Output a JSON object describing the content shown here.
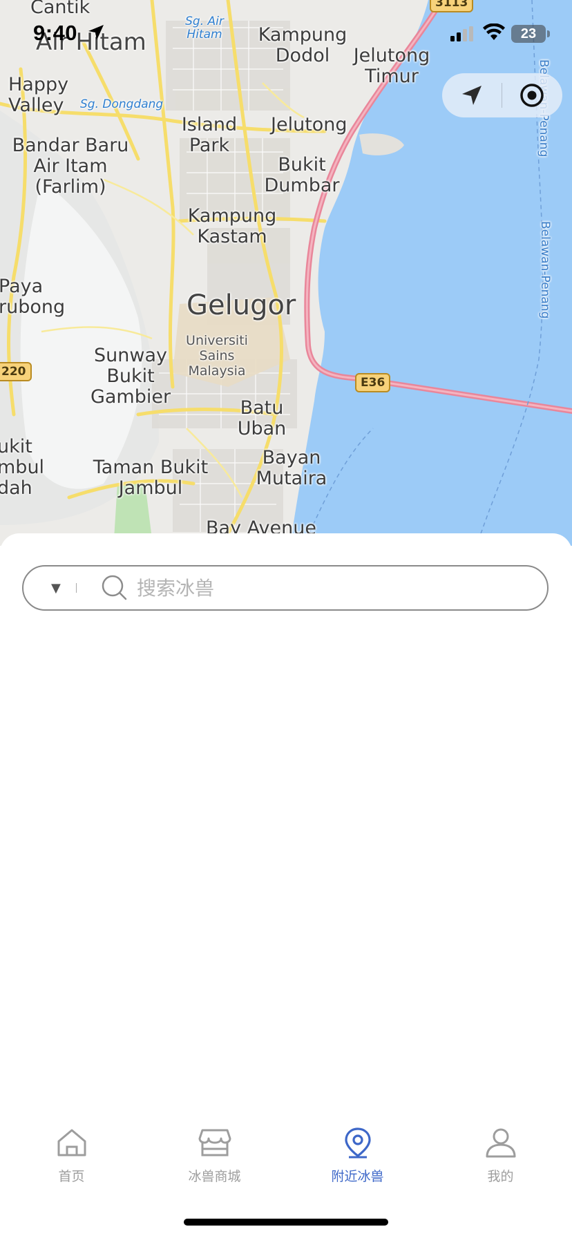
{
  "status_bar": {
    "time": "9:40",
    "battery": "23"
  },
  "map": {
    "labels": {
      "cantik": "Cantik",
      "air_hitam": "Air Hitam",
      "sg_air_hitam": "Sg. Air Hitam",
      "kampung_dodol": "Kampung Dodol",
      "jelutong_timur": "Jelutong Timur",
      "happy_valley": "Happy Valley",
      "sg_dongdang": "Sg. Dongdang",
      "island_park": "Island Park",
      "jelutong": "Jelutong",
      "bandar_baru": "Bandar Baru Air Itam (Farlim)",
      "bukit_dumbar": "Bukit Dumbar",
      "kampung_kastam": "Kampung Kastam",
      "paya_terubong": "Paya rubong",
      "gelugor": "Gelugor",
      "usm": "Universiti Sains Malaysia",
      "sunway": "Sunway Bukit Gambier",
      "batu_uban": "Batu Uban",
      "bukit_jambul": "ukit mbul dah",
      "taman_bukit_jambul": "Taman Bukit Jambul",
      "bayan_mutiara": "Bayan Mutaira",
      "bay_avenue": "Bay Avenue",
      "ferry_1": "Belawan-Penang",
      "ferry_2": "Belawan-Penang"
    },
    "shields": {
      "e36": "E36",
      "r220": "220",
      "r3113": "3113"
    }
  },
  "search": {
    "placeholder": "搜索冰兽",
    "value": ""
  },
  "tabs": [
    {
      "label": "首页",
      "icon": "home-icon"
    },
    {
      "label": "冰兽商城",
      "icon": "store-icon"
    },
    {
      "label": "附近冰兽",
      "icon": "location-pin-icon"
    },
    {
      "label": "我的",
      "icon": "profile-icon"
    }
  ],
  "colors": {
    "accent": "#3d67c8",
    "inactive": "#9d9d9d",
    "sea": "#9ccbf7",
    "highway": "#e9869a",
    "road": "#f7e27e"
  }
}
